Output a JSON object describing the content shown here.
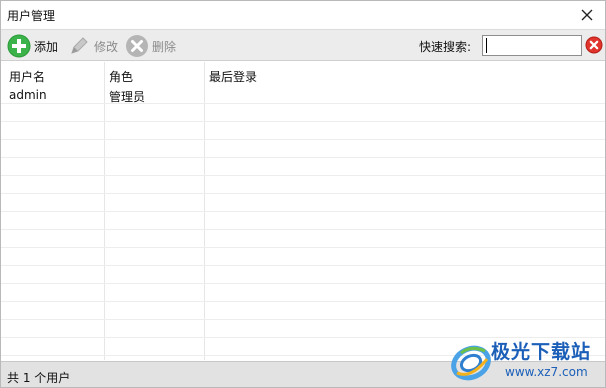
{
  "window": {
    "title": "用户管理"
  },
  "toolbar": {
    "add_label": "添加",
    "edit_label": "修改",
    "delete_label": "删除",
    "search_label": "快速搜索:",
    "search_value": ""
  },
  "grid": {
    "columns": [
      "用户名",
      "角色",
      "最后登录"
    ],
    "rows": [
      [
        "admin",
        "管理员",
        ""
      ]
    ]
  },
  "status": {
    "text": "共 1 个用户"
  },
  "watermark": {
    "title": "极光下载站",
    "url": "www.xz7.com"
  },
  "colors": {
    "add_green": "#3bb34a",
    "clear_red": "#e0342c",
    "watermark_blue": "#1b5fb8"
  }
}
